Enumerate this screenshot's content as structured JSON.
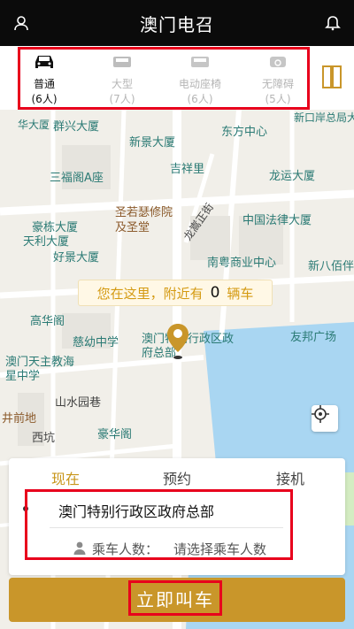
{
  "header": {
    "title": "澳门电召",
    "profile_icon": "person-icon",
    "notify_icon": "bell-icon"
  },
  "car_types": [
    {
      "label": "普通",
      "capacity": "(6人)",
      "icon": "sedan-icon",
      "active": true
    },
    {
      "label": "大型",
      "capacity": "(7人)",
      "icon": "van-icon",
      "active": false
    },
    {
      "label": "电动座椅",
      "capacity": "(6人)",
      "icon": "seat-icon",
      "active": false
    },
    {
      "label": "无障碍",
      "capacity": "(5人)",
      "icon": "wheelchair-icon",
      "active": false
    }
  ],
  "map": {
    "pois": [
      "群兴大厦",
      "华大厦",
      "新景大厦",
      "东方中心",
      "新口岸总局大",
      "三福阁A座",
      "吉祥里",
      "龙运大厦",
      "圣若瑟修院及圣堂",
      "中国法律大厦",
      "豪栋大厦",
      "天利大厦",
      "龙嵩正街",
      "好景大厦",
      "南粤商业中心",
      "新八佰伴",
      "高华阁",
      "慈幼中学",
      "澳门特别行政区政府总部",
      "友邦广场",
      "澳门天主教海星中学",
      "山水园巷",
      "井前地",
      "豪华阁",
      "西坑"
    ],
    "near_prefix": "您在这里，附近有",
    "near_count": "0",
    "near_suffix": "辆车"
  },
  "panel": {
    "tabs": [
      "现在",
      "预约",
      "接机"
    ],
    "active_tab": "现在",
    "address": "澳门特别行政区政府总部",
    "pax_label": "乘车人数：",
    "pax_placeholder": "请选择乘车人数"
  },
  "call_button": "立即叫车",
  "colors": {
    "accent": "#c9962a",
    "highlight": "#e8001c",
    "header_bg": "#0b0b0b"
  }
}
